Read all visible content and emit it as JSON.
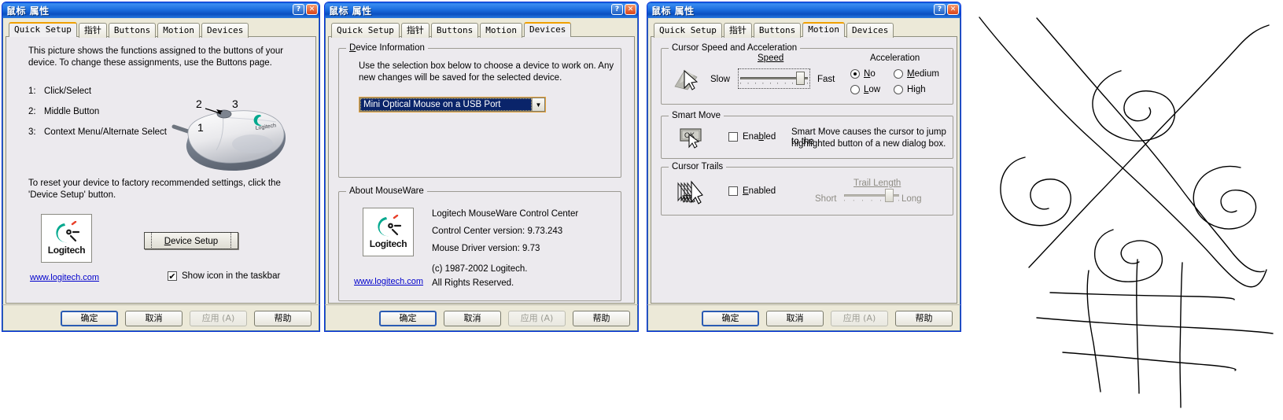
{
  "window_title": "鼠标 属性",
  "titlebar": {
    "help": "?",
    "close": "✕"
  },
  "tabs": [
    "Quick Setup",
    "指针",
    "Buttons",
    "Motion",
    "Devices"
  ],
  "buttons": {
    "ok": "确定",
    "cancel": "取消",
    "apply": "应用 (A)",
    "help": "帮助"
  },
  "panel1": {
    "intro_line1": "This picture shows the functions assigned to the buttons of your",
    "intro_line2": "device.  To change these assignments, use the Buttons page.",
    "items": [
      {
        "num": "1:",
        "label": "Click/Select"
      },
      {
        "num": "2:",
        "label": "Middle Button"
      },
      {
        "num": "3:",
        "label": "Context Menu/Alternate Select"
      }
    ],
    "callouts": [
      "1",
      "2",
      "3"
    ],
    "reset_line1": "To reset your device to factory recommended settings, click the",
    "reset_line2": "'Device Setup' button.",
    "device_setup_button": "Device Setup",
    "logo_text": "Logitech",
    "link": "www.logitech.com",
    "taskbar_checkbox": "Show icon in the taskbar",
    "taskbar_checked": true
  },
  "panel2": {
    "group_device_info": "Device Information",
    "info_line1": "Use the selection box below to choose a device to work on. Any",
    "info_line2": "new changes will be saved for the selected device.",
    "combo_value": "Mini Optical Mouse on a USB Port",
    "group_about": "About MouseWare",
    "about_line1": "Logitech MouseWare Control Center",
    "about_line2": "Control Center version:  9.73.243",
    "about_line3": "Mouse Driver version:  9.73",
    "about_line4": "(c) 1987-2002 Logitech.",
    "about_line5": "All Rights Reserved.",
    "logo_text": "Logitech",
    "link": "www.logitech.com"
  },
  "panel3": {
    "group_speed": "Cursor Speed and Acceleration",
    "speed_label": "Speed",
    "speed_min": "Slow",
    "speed_max": "Fast",
    "speed_value_pct": 82,
    "accel_label": "Acceleration",
    "accel_options": [
      {
        "label": "No",
        "selected": true
      },
      {
        "label": "Medium",
        "selected": false
      },
      {
        "label": "Low",
        "selected": false
      },
      {
        "label": "High",
        "selected": false
      }
    ],
    "group_smartmove": "Smart Move",
    "smartmove_enabled_label": "Enabled",
    "smartmove_checked": false,
    "smartmove_desc1": "Smart Move causes the cursor to jump to the",
    "smartmove_desc2": "highlighted button of a new dialog box.",
    "smartmove_icon_text": "OK",
    "group_trails": "Cursor Trails",
    "trails_enabled_label": "Enabled",
    "trails_checked": false,
    "trail_length_label": "Trail Length",
    "trail_min": "Short",
    "trail_max": "Long",
    "trail_value_pct": 78
  },
  "colors": {
    "titlebar_blue": "#0a5ed7",
    "dialog_face": "#eceaee",
    "active_tab_accent": "#f0a000",
    "logitech_teal": "#00a88e",
    "logitech_red": "#e8402a",
    "link_blue": "#0000cc",
    "combo_highlight": "#0a246a"
  },
  "sketch": {
    "description": "freehand ink drawing: four spirals around a large X, and a grid of crossing lines below",
    "stroke_color": "#000000",
    "stroke_width": 1.4
  }
}
